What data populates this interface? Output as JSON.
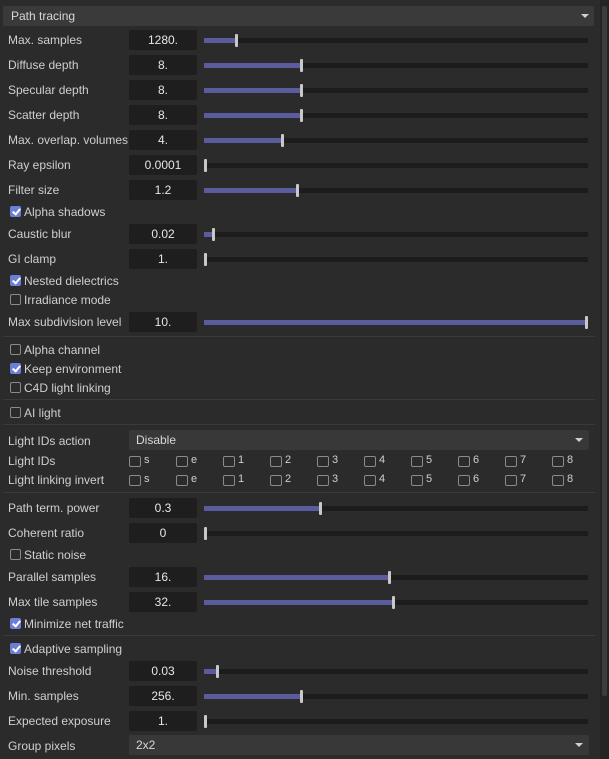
{
  "header": {
    "title": "Path tracing"
  },
  "sliders": {
    "max_samples": {
      "label": "Max. samples",
      "value": "1280.",
      "fraction": 0.08
    },
    "diffuse_depth": {
      "label": "Diffuse depth",
      "value": "8.",
      "fraction": 0.25
    },
    "specular_depth": {
      "label": "Specular depth",
      "value": "8.",
      "fraction": 0.25
    },
    "scatter_depth": {
      "label": "Scatter depth",
      "value": "8.",
      "fraction": 0.25
    },
    "max_overlap_volumes": {
      "label": "Max. overlap. volumes",
      "value": "4.",
      "fraction": 0.2
    },
    "ray_epsilon": {
      "label": "Ray epsilon",
      "value": "0.0001",
      "fraction": 0.0
    },
    "filter_size": {
      "label": "Filter size",
      "value": "1.2",
      "fraction": 0.24
    },
    "caustic_blur": {
      "label": "Caustic blur",
      "value": "0.02",
      "fraction": 0.02
    },
    "gi_clamp": {
      "label": "GI clamp",
      "value": "1.",
      "fraction": 0.0
    },
    "max_subdivision_level": {
      "label": "Max subdivision level",
      "value": "10.",
      "fraction": 1.0
    },
    "path_term_power": {
      "label": "Path term. power",
      "value": "0.3",
      "fraction": 0.3
    },
    "coherent_ratio": {
      "label": "Coherent ratio",
      "value": "0",
      "fraction": 0.0
    },
    "parallel_samples": {
      "label": "Parallel samples",
      "value": "16.",
      "fraction": 0.48
    },
    "max_tile_samples": {
      "label": "Max tile samples",
      "value": "32.",
      "fraction": 0.49
    },
    "noise_threshold": {
      "label": "Noise threshold",
      "value": "0.03",
      "fraction": 0.03
    },
    "min_samples": {
      "label": "Min. samples",
      "value": "256.",
      "fraction": 0.25
    },
    "expected_exposure": {
      "label": "Expected exposure",
      "value": "1.",
      "fraction": 0.0
    }
  },
  "checkboxes": {
    "alpha_shadows": {
      "label": "Alpha shadows",
      "checked": true
    },
    "nested_dielectrics": {
      "label": "Nested dielectrics",
      "checked": true
    },
    "irradiance_mode": {
      "label": "Irradiance mode",
      "checked": false
    },
    "alpha_channel": {
      "label": "Alpha channel",
      "checked": false
    },
    "keep_environment": {
      "label": "Keep environment",
      "checked": true
    },
    "c4d_light_linking": {
      "label": "C4D light linking",
      "checked": false
    },
    "ai_light": {
      "label": "AI light",
      "checked": false
    },
    "static_noise": {
      "label": "Static noise",
      "checked": false
    },
    "minimize_net_traffic": {
      "label": "Minimize net traffic",
      "checked": true
    },
    "adaptive_sampling": {
      "label": "Adaptive sampling",
      "checked": true
    }
  },
  "light_ids_action": {
    "label": "Light IDs action",
    "value": "Disable"
  },
  "light_ids": {
    "label": "Light IDs",
    "items": [
      "s",
      "e",
      "1",
      "2",
      "3",
      "4",
      "5",
      "6",
      "7",
      "8"
    ]
  },
  "light_linking_invert": {
    "label": "Light linking invert",
    "items": [
      "s",
      "e",
      "1",
      "2",
      "3",
      "4",
      "5",
      "6",
      "7",
      "8"
    ]
  },
  "group_pixels": {
    "label": "Group pixels",
    "value": "2x2"
  },
  "colors": {
    "accent": "#5a5c9e",
    "checkbox_on": "#6b7fd8",
    "background": "#2b2b2b"
  }
}
